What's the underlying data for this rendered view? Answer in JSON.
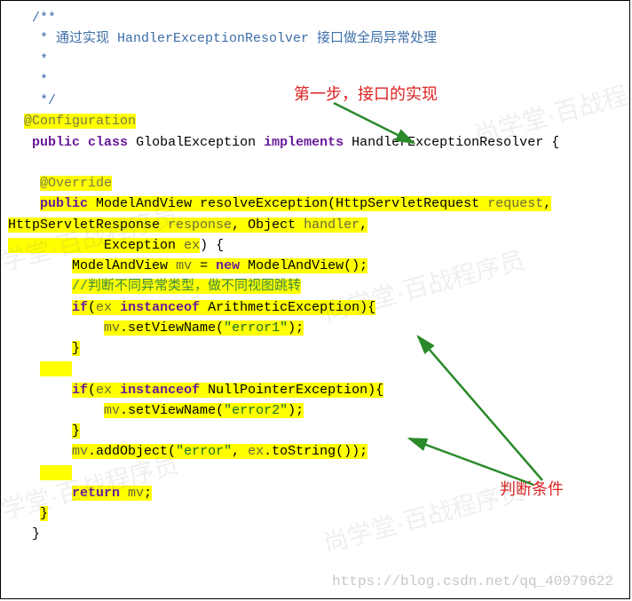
{
  "comment": {
    "open": "/**",
    "line1": " * 通过实现 HandlerExceptionResolver 接口做全局异常处理",
    "blank1": " *",
    "blank2": " *",
    "close": " */"
  },
  "annotation1": "@Configuration",
  "class_decl": {
    "public": "public",
    "class_kw": "class",
    "name": "GlobalException",
    "implements_kw": "implements",
    "iface": "HandlerExceptionResolver",
    "brace": "{"
  },
  "override": "@Override",
  "method": {
    "public": "public",
    "ret": "ModelAndView",
    "name": "resolveException",
    "p1t": "HttpServletRequest",
    "p1n": "request",
    "p2t": "HttpServletResponse",
    "p2n": "response",
    "p3t": "Object",
    "p3n": "handler",
    "p4t": "Exception",
    "p4n": "ex",
    "brace": ") {"
  },
  "body": {
    "mvdecl_type": "ModelAndView",
    "mvdecl_var": "mv",
    "eq": " = ",
    "new_kw": "new",
    "mvctor": " ModelAndView();",
    "cmt": "//判断不同异常类型，做不同视图跳转",
    "if1_kw": "if",
    "if1_open": "(",
    "if1_var": "ex",
    "instanceof": "instanceof",
    "if1_type": "ArithmeticException",
    "if1_close": "){",
    "set1_obj": "mv",
    "set1_call": ".setViewName(",
    "set1_str": "\"error1\"",
    "set1_end": ");",
    "close1": "}",
    "if2_type": "NullPointerException",
    "set2_str": "\"error2\"",
    "close2": "}",
    "add_obj": "mv",
    "add_call": ".addObject(",
    "add_s1": "\"error\"",
    "add_comma": ", ",
    "add_s2var": "ex",
    "add_s2rest": ".toString());",
    "return_kw": "return",
    "return_var": "mv",
    "semi": ";",
    "close_method": "}",
    "close_class": "}"
  },
  "anno1": "第一步，接口的实现",
  "anno2": "判断条件",
  "footer": "https://blog.csdn.net/qq_40979622",
  "watermarks": [
    "尚学堂·百战程序员",
    "尚学堂·百战程序员",
    "尚学堂·百战程序员",
    "尚学堂·百战程序员",
    "尚学堂·百战程序员"
  ]
}
